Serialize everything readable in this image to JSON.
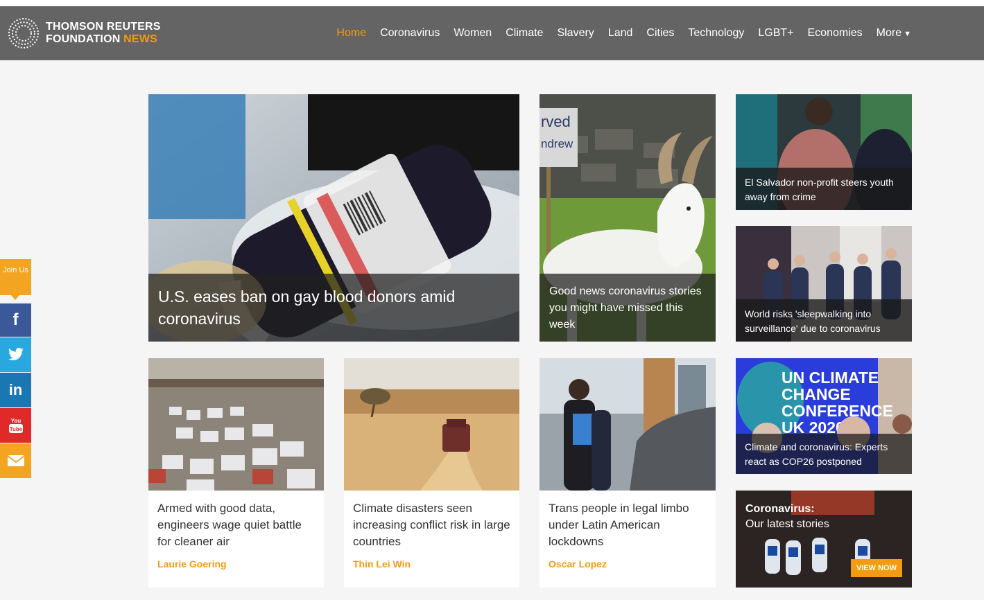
{
  "brand": {
    "line1": "THOMSON REUTERS",
    "line2a": "FOUNDATION ",
    "line2b": "NEWS",
    "accent": "#f39c12",
    "nav_bg": "#646464"
  },
  "nav": {
    "items": [
      "Home",
      "Coronavirus",
      "Women",
      "Climate",
      "Slavery",
      "Land",
      "Cities",
      "Technology",
      "LGBT+",
      "Economies",
      "More"
    ],
    "active": "Home",
    "more_icon": "chevron-down-icon"
  },
  "social": {
    "join_label": "Join Us",
    "buttons": [
      {
        "icon": "facebook-icon",
        "glyph": "f",
        "color": "#3b5998"
      },
      {
        "icon": "twitter-icon",
        "glyph": "🐦",
        "color": "#29a8e0"
      },
      {
        "icon": "linkedin-icon",
        "glyph": "in",
        "color": "#1a77b2"
      },
      {
        "icon": "youtube-icon",
        "glyph": "You Tube",
        "color": "#e02a2a"
      },
      {
        "icon": "mail-icon",
        "glyph": "✉",
        "color": "#f3a521"
      }
    ]
  },
  "stories": {
    "hero": {
      "headline": "U.S. eases ban on gay blood donors amid coronavirus"
    },
    "goat": {
      "headline": "Good news coronavirus stories you might have missed this week"
    },
    "sign_text": "rved\nndrew",
    "el_salvador": {
      "headline": "El Salvador non-profit steers youth away from crime"
    },
    "surveillance": {
      "headline": "World risks 'sleepwalking into surveillance' due to coronavirus"
    },
    "cop26": {
      "headline": "Climate and coronavirus: Experts react as COP26 postponed",
      "banner": "UN CLIMATE CHANGE CONFERENCE UK 2020"
    },
    "latest": {
      "title_line1": "Coronavirus:",
      "title_line2": "Our latest stories",
      "button": "VIEW NOW"
    },
    "bottom": [
      {
        "headline": "Armed with good data, engineers wage quiet battle for cleaner air",
        "author": "Laurie Goering"
      },
      {
        "headline": "Climate disasters seen increasing conflict risk in large countries",
        "author": "Thin Lei Win"
      },
      {
        "headline": "Trans people in legal limbo under Latin American lockdowns",
        "author": "Oscar Lopez"
      }
    ]
  }
}
